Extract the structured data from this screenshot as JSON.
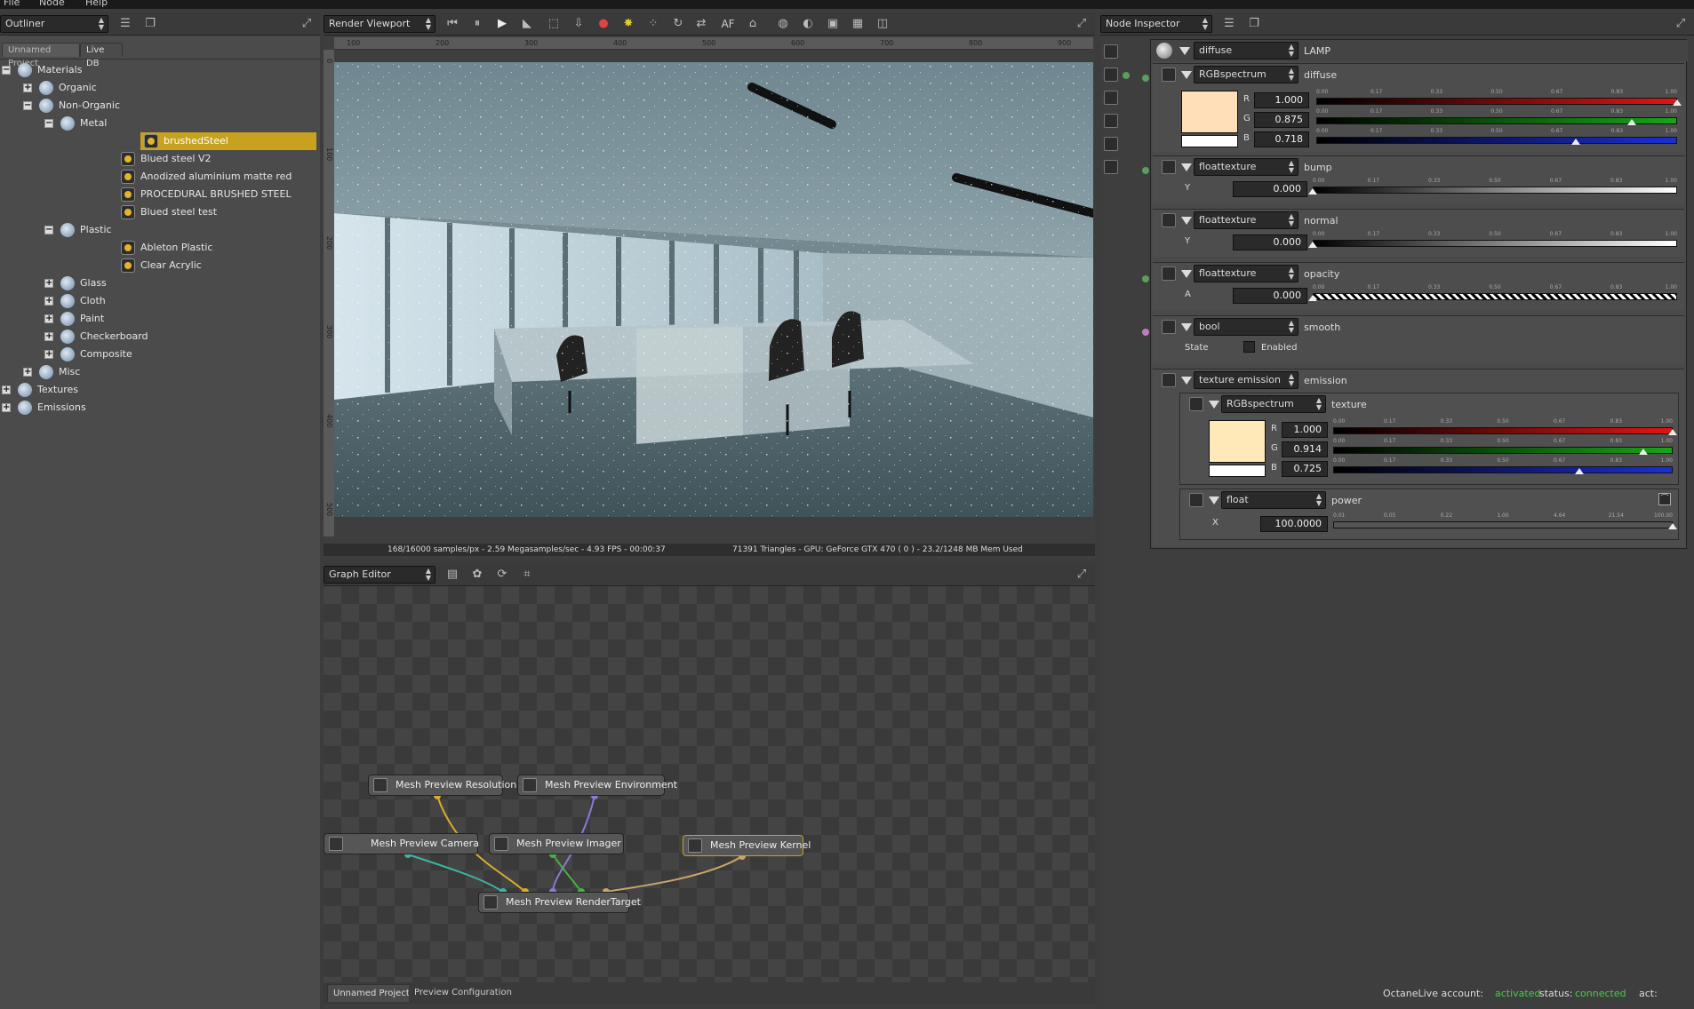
{
  "menubar": {
    "items": [
      "File",
      "Node",
      "Help"
    ]
  },
  "outliner": {
    "panel_title": "Outliner",
    "tabs": [
      "Unnamed Project",
      "Live DB"
    ],
    "tree": [
      {
        "label": "Materials",
        "level": 0,
        "expander": "minus",
        "icon": "folder"
      },
      {
        "label": "Organic",
        "level": 1,
        "expander": "plus",
        "icon": "folder"
      },
      {
        "label": "Non-Organic",
        "level": 1,
        "expander": "minus",
        "icon": "folder"
      },
      {
        "label": "Metal",
        "level": 2,
        "expander": "minus",
        "icon": "folder"
      },
      {
        "label": "brushedSteel",
        "level": 3,
        "expander": "",
        "icon": "material",
        "selected": true
      },
      {
        "label": "Blued steel V2",
        "level": 3,
        "expander": "",
        "icon": "material"
      },
      {
        "label": "Anodized aluminium matte red",
        "level": 3,
        "expander": "",
        "icon": "material"
      },
      {
        "label": "PROCEDURAL BRUSHED STEEL",
        "level": 3,
        "expander": "",
        "icon": "material"
      },
      {
        "label": "Blued steel test",
        "level": 3,
        "expander": "",
        "icon": "material"
      },
      {
        "label": "Plastic",
        "level": 2,
        "expander": "minus",
        "icon": "folder"
      },
      {
        "label": "Ableton Plastic",
        "level": 3,
        "expander": "",
        "icon": "material"
      },
      {
        "label": "Clear Acrylic",
        "level": 3,
        "expander": "",
        "icon": "material"
      },
      {
        "label": "Glass",
        "level": 2,
        "expander": "plus",
        "icon": "folder"
      },
      {
        "label": "Cloth",
        "level": 2,
        "expander": "plus",
        "icon": "folder"
      },
      {
        "label": "Paint",
        "level": 2,
        "expander": "plus",
        "icon": "folder"
      },
      {
        "label": "Checkerboard",
        "level": 2,
        "expander": "plus",
        "icon": "folder"
      },
      {
        "label": "Composite",
        "level": 2,
        "expander": "plus",
        "icon": "folder"
      },
      {
        "label": "Misc",
        "level": 1,
        "expander": "plus",
        "icon": "folder"
      },
      {
        "label": "Textures",
        "level": 0,
        "expander": "plus",
        "icon": "folder"
      },
      {
        "label": "Emissions",
        "level": 0,
        "expander": "plus",
        "icon": "folder"
      }
    ]
  },
  "viewport": {
    "panel_title": "Render Viewport",
    "toolbar_text": "AF",
    "ruler_top": [
      "100",
      "200",
      "300",
      "400",
      "500",
      "600",
      "700",
      "800",
      "900"
    ],
    "ruler_left": [
      "0",
      "100",
      "200",
      "300",
      "400",
      "500"
    ],
    "status_left": "168/16000 samples/px - 2.59 Megasamples/sec - 4.93 FPS - 00:00:37",
    "status_right": "71391 Triangles - GPU: GeForce GTX 470 ( 0 ) - 23.2/1248 MB Mem Used"
  },
  "graph": {
    "panel_title": "Graph Editor",
    "nodes": {
      "resolution": "Mesh Preview Resolution",
      "environment": "Mesh Preview Environment",
      "camera": "Mesh Preview Camera",
      "imager": "Mesh Preview Imager",
      "kernel": "Mesh Preview Kernel",
      "rendertarget": "Mesh Preview RenderTarget"
    },
    "tabs": [
      "Unnamed Project",
      "Preview Configuration"
    ]
  },
  "inspector": {
    "panel_title": "Node Inspector",
    "root": {
      "type": "diffuse",
      "name": "LAMP"
    },
    "slider_ticks": [
      "0.00",
      "0.17",
      "0.33",
      "0.50",
      "0.67",
      "0.83",
      "1.00"
    ],
    "power_ticks": [
      "0.01",
      "0.05",
      "0.22",
      "1.00",
      "4.64",
      "21.54",
      "100.00"
    ],
    "diffuse": {
      "type": "RGBspectrum",
      "name": "diffuse",
      "r_label": "R",
      "g_label": "G",
      "b_label": "B",
      "r": "1.000",
      "g": "0.875",
      "b": "0.718",
      "r_val": 1.0,
      "g_val": 0.875,
      "b_val": 0.718,
      "swatch": "#ffdfb7"
    },
    "bump": {
      "type": "floattexture",
      "name": "bump",
      "label": "Y",
      "value": "0.000",
      "val": 0.0
    },
    "normal": {
      "type": "floattexture",
      "name": "normal",
      "label": "Y",
      "value": "0.000",
      "val": 0.0
    },
    "opacity": {
      "type": "floattexture",
      "name": "opacity",
      "label": "A",
      "value": "0.000",
      "val": 0.0
    },
    "smooth": {
      "type": "bool",
      "name": "smooth",
      "state_label": "State",
      "checkbox_label": "Enabled"
    },
    "emission": {
      "type": "texture emission",
      "name": "emission",
      "texture": {
        "type": "RGBspectrum",
        "name": "texture",
        "r_label": "R",
        "g_label": "G",
        "b_label": "B",
        "r": "1.000",
        "g": "0.914",
        "b": "0.725",
        "r_val": 1.0,
        "g_val": 0.914,
        "b_val": 0.725,
        "swatch": "#ffe9b9"
      },
      "power": {
        "type": "float",
        "name": "power",
        "label": "X",
        "value": "100.0000",
        "val": 1.0
      }
    }
  },
  "footer": {
    "account_label": "OctaneLive account:",
    "account_value": "activated",
    "status_label": "status:",
    "status_value": "connected",
    "act_label": "act:"
  },
  "colors": {
    "accent": "#c8a21e",
    "ok": "#3fd23f",
    "red": "#e01515",
    "green": "#17a617",
    "blue": "#1a2fd8"
  }
}
